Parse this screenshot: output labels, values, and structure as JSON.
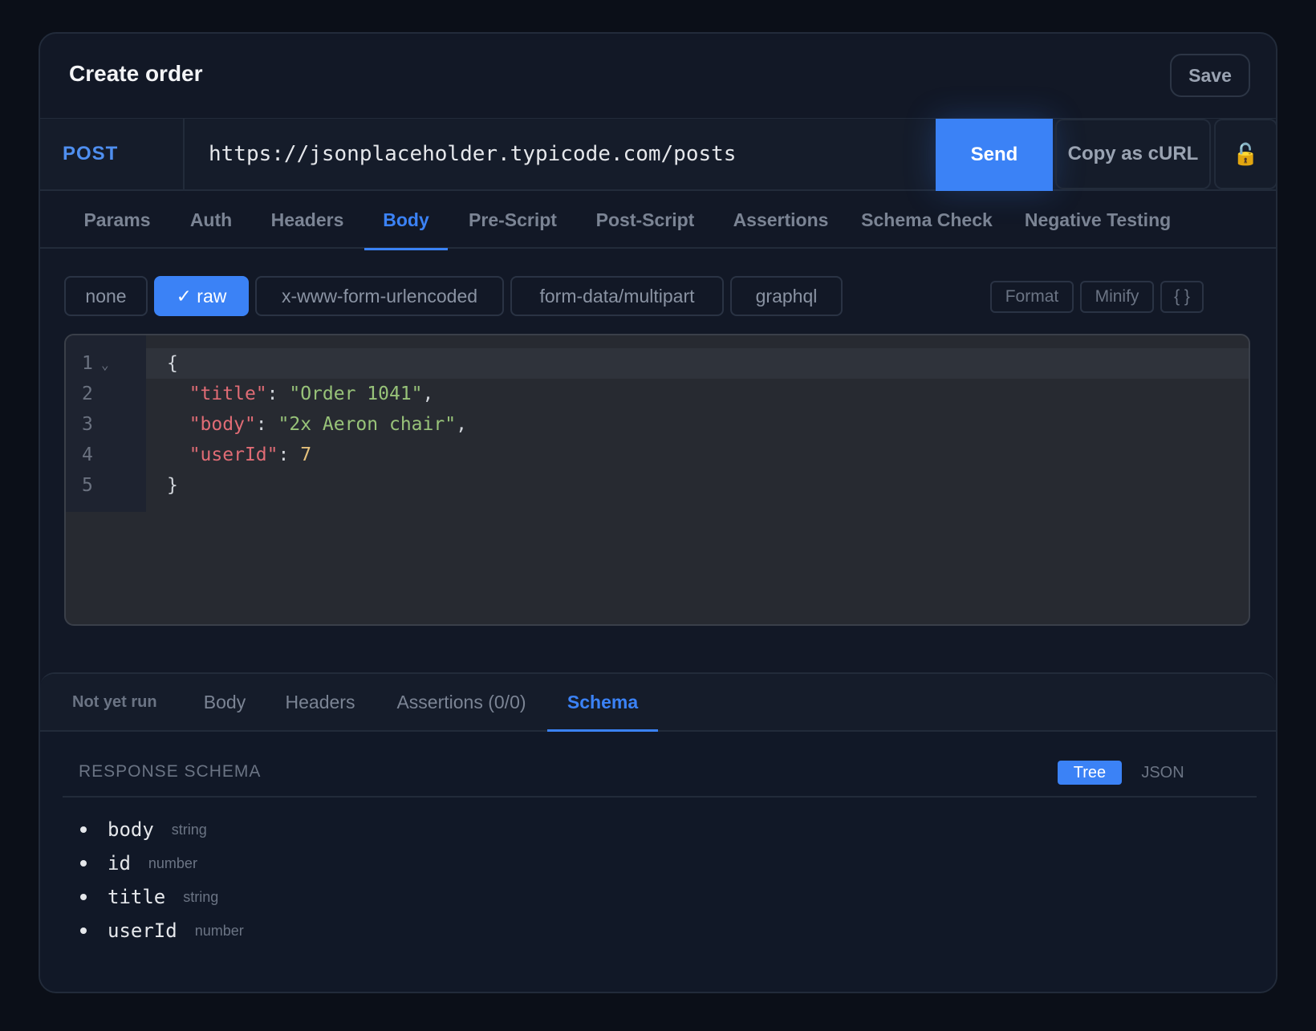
{
  "header": {
    "title": "Create order",
    "save_label": "Save"
  },
  "request": {
    "method": "POST",
    "url": "https://jsonplaceholder.typicode.com/posts",
    "send_label": "Send",
    "copy_curl_label": "Copy as cURL",
    "lock_icon": "🔓"
  },
  "request_tabs": [
    "Params",
    "Auth",
    "Headers",
    "Body",
    "Pre-Script",
    "Post-Script",
    "Assertions",
    "Schema Check",
    "Negative Testing"
  ],
  "active_request_tab": "Body",
  "body_types": [
    "none",
    "✓ raw",
    "x-www-form-urlencoded",
    "form-data/multipart",
    "graphql"
  ],
  "active_body_type": "raw",
  "editor_tools": [
    "Format",
    "Minify",
    "{ }"
  ],
  "editor": {
    "line_numbers": [
      "1",
      "2",
      "3",
      "4",
      "5"
    ],
    "json": {
      "title": "Order 1041",
      "body": "2x Aeron chair",
      "userId": 7
    }
  },
  "response": {
    "status": "Not yet run",
    "tabs": [
      "Body",
      "Headers",
      "Assertions (0/0)",
      "Schema"
    ],
    "active_tab": "Schema",
    "schema_label": "RESPONSE SCHEMA",
    "view_modes": [
      "Tree",
      "JSON"
    ],
    "active_view_mode": "Tree",
    "fields": [
      {
        "name": "body",
        "type": "string"
      },
      {
        "name": "id",
        "type": "number"
      },
      {
        "name": "title",
        "type": "string"
      },
      {
        "name": "userId",
        "type": "number"
      }
    ]
  }
}
